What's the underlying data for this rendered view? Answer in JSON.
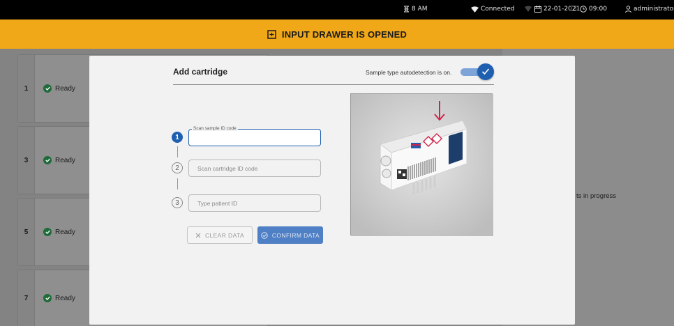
{
  "status_bar": {
    "time_label": "8 AM",
    "connection": "Connected",
    "date": "22-01-2021",
    "clock": "09:00",
    "user": "administrator"
  },
  "banner": {
    "text": "INPUT DRAWER IS OPENED",
    "color": "#f0a818"
  },
  "slots": [
    {
      "number": "1",
      "status": "Ready"
    },
    {
      "number": "3",
      "status": "Ready"
    },
    {
      "number": "5",
      "status": "Ready"
    },
    {
      "number": "7",
      "status": "Ready"
    }
  ],
  "right_pane": {
    "status_text": "ts in progress"
  },
  "modal": {
    "title": "Add cartridge",
    "autodetect_text": "Sample type autodetection is on.",
    "autodetect_on": true,
    "steps": [
      {
        "number": "1",
        "label": "Scan sample ID code",
        "value": "",
        "active": true
      },
      {
        "number": "2",
        "placeholder": "Scan cartridge ID code",
        "active": false
      },
      {
        "number": "3",
        "placeholder": "Type patient ID",
        "active": false
      }
    ],
    "buttons": {
      "clear": "CLEAR DATA",
      "confirm": "CONFIRM DATA"
    },
    "accent_color": "#1f5fb0"
  }
}
